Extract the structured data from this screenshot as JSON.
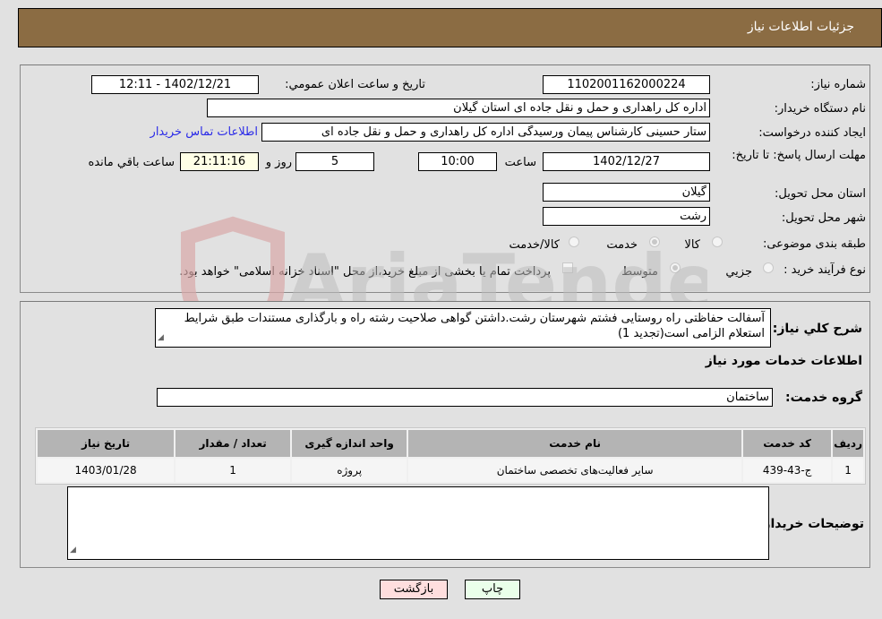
{
  "header": {
    "title": "جزئیات اطلاعات نیاز"
  },
  "details": {
    "need_number_label": "شماره نیاز:",
    "need_number": "1102001162000224",
    "announce_label": "تاریخ و ساعت اعلان عمومي:",
    "announce_value": "1402/12/21 - 12:11",
    "buyer_org_label": "نام دستگاه خریدار:",
    "buyer_org": "اداره کل راهداری و حمل و نقل جاده ای استان گیلان",
    "requester_label": "ایجاد کننده درخواست:",
    "requester": "ستار حسینی کارشناس پیمان ورسیدگی اداره کل راهداری و حمل و نقل جاده ای",
    "contact_link": "اطلاعات تماس خریدار",
    "deadline_label": "مهلت ارسال پاسخ: تا تاریخ:",
    "deadline_date": "1402/12/27",
    "time_label": "ساعت",
    "deadline_time": "10:00",
    "days_value": "5",
    "days_label": "روز و",
    "remaining_time": "21:11:16",
    "remaining_label": "ساعت باقي مانده",
    "province_label": "استان محل تحویل:",
    "province": "گیلان",
    "city_label": "شهر محل تحویل:",
    "city": "رشت",
    "category_label": "طبقه بندی موضوعی:",
    "category_options": [
      {
        "label": "کالا",
        "selected": false
      },
      {
        "label": "خدمت",
        "selected": true
      },
      {
        "label": "کالا/خدمت",
        "selected": false
      }
    ],
    "process_label": "نوع فرآیند خرید :",
    "process_options": [
      {
        "label": "جزيي",
        "selected": false
      },
      {
        "label": "متوسط",
        "selected": true
      }
    ],
    "treasury_checkbox_label": "پرداخت تمام یا بخشی از مبلغ خرید،از محل \"اسناد خزانه اسلامی\" خواهد بود.",
    "treasury_checked": false
  },
  "description": {
    "label": "شرح کلي نیاز:",
    "text": "آسفالت حفاظتی راه روستایی فشتم  شهرستان رشت.داشتن گواهی صلاحیت رشته راه و بارگذاری مستندات طبق شرایط استعلام الزامی است(تجدید 1)"
  },
  "services": {
    "section_title": "اطلاعات خدمات مورد نیاز",
    "group_label": "گروه خدمت:",
    "group_value": "ساختمان",
    "columns": [
      "ردیف",
      "کد خدمت",
      "نام خدمت",
      "واحد اندازه گیری",
      "تعداد / مقدار",
      "تاریخ نیاز"
    ],
    "rows": [
      [
        "1",
        "ج-43-439",
        "سایر فعالیت‌های تخصصی ساختمان",
        "پروژه",
        "1",
        "1403/01/28"
      ]
    ]
  },
  "buyer_notes": {
    "label": "توضیحات خریدار:",
    "text": ""
  },
  "buttons": {
    "print": "چاپ",
    "back": "بازگشت"
  },
  "watermark": {
    "text": "AriaTender.neT"
  }
}
